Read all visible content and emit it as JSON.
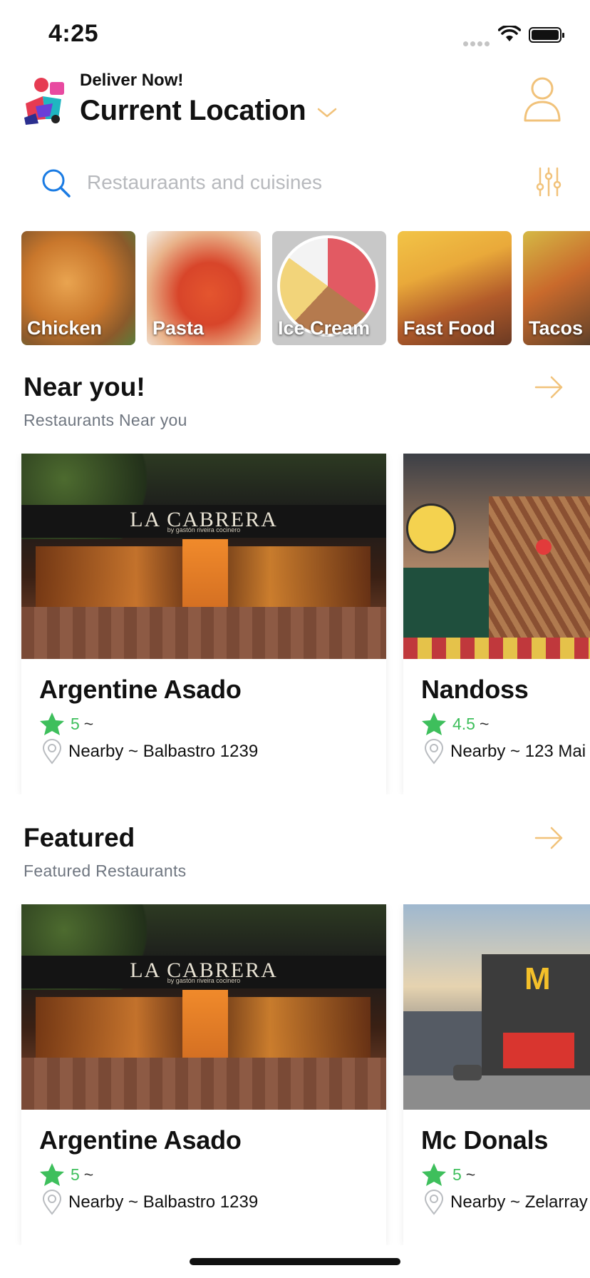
{
  "status": {
    "time": "4:25"
  },
  "header": {
    "deliver_label": "Deliver Now!",
    "location": "Current Location"
  },
  "search": {
    "placeholder": "Restauraants and cuisines"
  },
  "categories": [
    {
      "label": "Chicken"
    },
    {
      "label": "Pasta"
    },
    {
      "label": "Ice Cream",
      "selected": true
    },
    {
      "label": "Fast Food"
    },
    {
      "label": "Tacos"
    }
  ],
  "near_you": {
    "title": "Near you!",
    "subtitle": "Restaurants Near you",
    "restaurants": [
      {
        "name": "Argentine Asado",
        "rating": "5",
        "address": "Nearby ~ Balbastro 1239",
        "sign": "LA CABRERA",
        "sign_sub": "by gastón riveira cocinero"
      },
      {
        "name": "Nandoss",
        "rating": "4.5",
        "address": "Nearby ~ 123 Mai"
      }
    ]
  },
  "featured": {
    "title": "Featured",
    "subtitle": "Featured Restaurants",
    "restaurants": [
      {
        "name": "Argentine Asado",
        "rating": "5",
        "address": "Nearby ~ Balbastro 1239",
        "sign": "LA CABRERA",
        "sign_sub": "by gastón riveira cocinero"
      },
      {
        "name": "Mc Donals",
        "rating": "5",
        "address": "Nearby ~ Zelarray"
      }
    ]
  },
  "colors": {
    "accent": "#f1c27a",
    "rating_green": "#3ebf5c",
    "search_blue": "#1a7be3"
  }
}
